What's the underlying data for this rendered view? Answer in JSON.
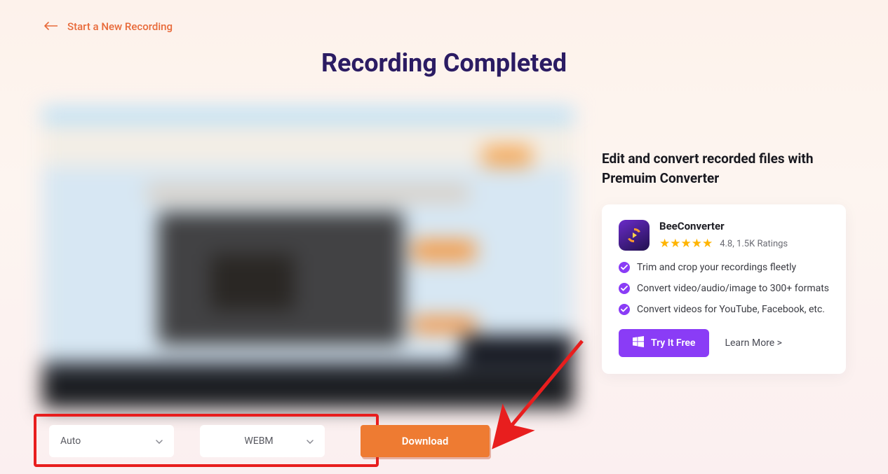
{
  "back_link": "Start a New Recording",
  "page_title": "Recording Completed",
  "dropdowns": {
    "quality": "Auto",
    "format": "WEBM"
  },
  "download_label": "Download",
  "promo": {
    "heading": "Edit and convert recorded files with Premuim Converter",
    "app_name": "BeeConverter",
    "rating_text": "4.8, 1.5K Ratings",
    "features": [
      "Trim and crop your recordings fleetly",
      "Convert video/audio/image to 300+ formats",
      "Convert videos for YouTube, Facebook, etc."
    ],
    "try_label": "Try It Free",
    "learn_label": "Learn More >"
  }
}
